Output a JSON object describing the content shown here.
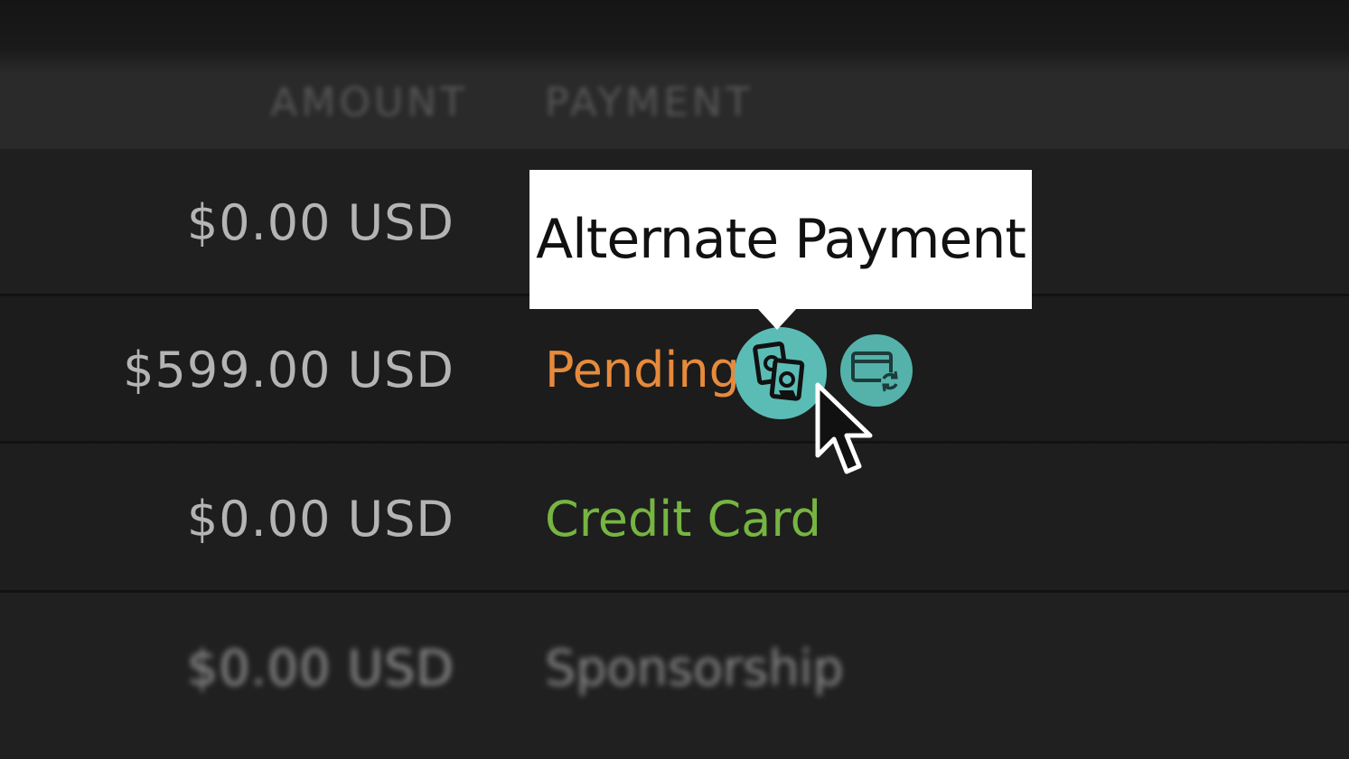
{
  "table": {
    "headers": {
      "amount": "AMOUNT",
      "payment": "PAYMENT"
    },
    "rows": [
      {
        "amount": "$0.00 USD",
        "payment": ""
      },
      {
        "amount": "$599.00 USD",
        "payment": "Pending"
      },
      {
        "amount": "$0.00 USD",
        "payment": "Credit Card"
      },
      {
        "amount": "$0.00 USD",
        "payment": "Sponsorship"
      }
    ]
  },
  "actions": {
    "alternate_payment": {
      "icon": "cash-exchange-icon"
    },
    "change_card": {
      "icon": "card-refresh-icon"
    }
  },
  "tooltip": {
    "text": "Alternate Payment"
  },
  "colors": {
    "pending": "#e68a3c",
    "credit_card": "#76b541",
    "action_button": "#5bbcb6",
    "tooltip_bg": "#ffffff"
  }
}
